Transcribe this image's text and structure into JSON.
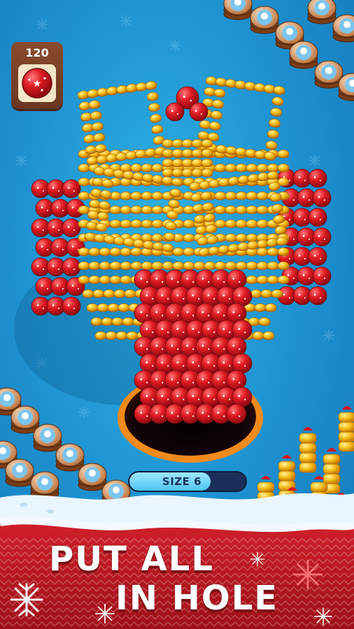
{
  "hud": {
    "ball_count": "120",
    "size_label": "SIZE 6",
    "size_progress": 0.7
  },
  "banner": {
    "line1": "PUT ALL",
    "line2": "IN HOLE"
  },
  "colors": {
    "background": "#1d8fcf",
    "ball_red": "#d9131c",
    "ball_yellow": "#f6b312",
    "banner_red": "#c4161f",
    "hole_rim": "#f28a1c",
    "progress_fill": "#4cc4f0"
  },
  "icons": [
    "ball-icon",
    "snowflake-icon",
    "snowman-coin-icon",
    "stocking-icon"
  ]
}
